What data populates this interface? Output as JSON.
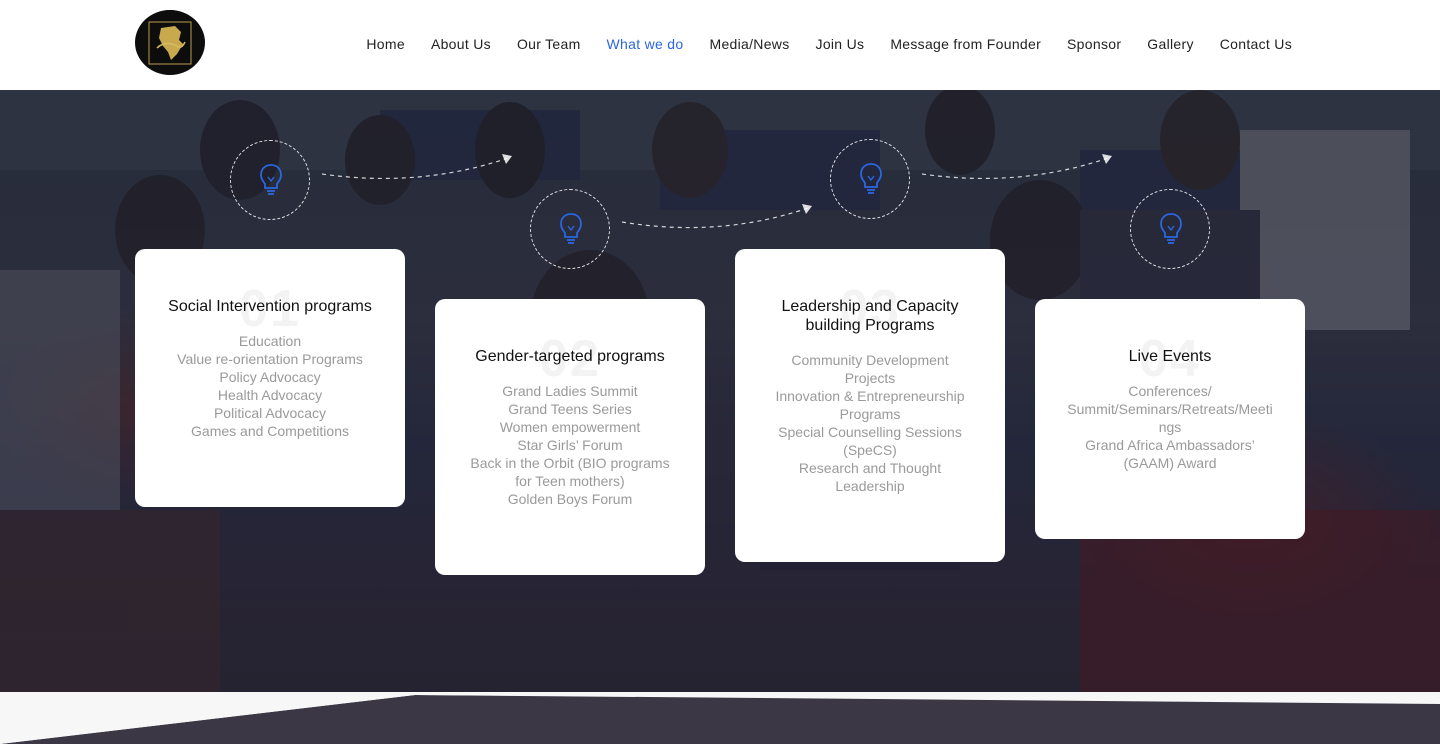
{
  "header": {
    "nav": [
      {
        "label": "Home",
        "active": false
      },
      {
        "label": "About Us",
        "active": false
      },
      {
        "label": "Our Team",
        "active": false
      },
      {
        "label": "What we do",
        "active": true
      },
      {
        "label": "Media/News",
        "active": false
      },
      {
        "label": "Join Us",
        "active": false
      },
      {
        "label": "Message from Founder",
        "active": false
      },
      {
        "label": "Sponsor",
        "active": false
      },
      {
        "label": "Gallery",
        "active": false
      },
      {
        "label": "Contact Us",
        "active": false
      }
    ],
    "accent_color": "#2b66e0"
  },
  "programs": [
    {
      "number": "01",
      "title": "Social Intervention programs",
      "items": [
        "Education",
        "Value re-orientation Programs",
        "Policy Advocacy",
        "Health Advocacy",
        "Political Advocacy",
        "Games and Competitions"
      ]
    },
    {
      "number": "02",
      "title": "Gender-targeted programs",
      "items": [
        "Grand Ladies Summit",
        "Grand Teens Series",
        "Women empowerment",
        "Star Girls’ Forum",
        "Back in the Orbit (BIO programs for Teen mothers)",
        "Golden Boys Forum"
      ]
    },
    {
      "number": "03",
      "title": "Leadership and Capacity building Programs",
      "items": [
        "Community Development Projects",
        "Innovation & Entrepreneurship Programs",
        "Special Counselling Sessions (SpeCS)",
        "Research and Thought Leadership"
      ]
    },
    {
      "number": "04",
      "title": "Live Events",
      "items": [
        "Conferences/ Summit/Seminars/Retreats/Meetings",
        "Grand Africa Ambassadors’ (GAAM) Award"
      ]
    }
  ],
  "icons": {
    "program_icon": "lightbulb-icon",
    "icon_color": "#2b66e0"
  }
}
